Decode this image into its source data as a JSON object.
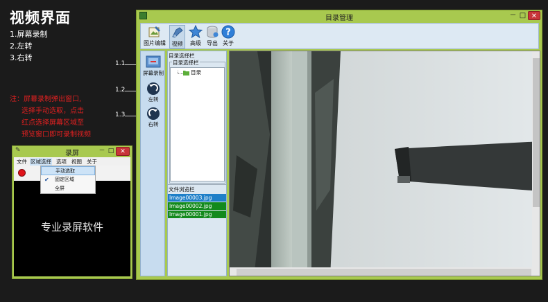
{
  "page": {
    "heading": "视频界面",
    "features": [
      "1.屏幕录制",
      "2.左转",
      "3.右转"
    ],
    "note": [
      "注：屏幕录制弹出窗口,",
      "选择手动选取，点击",
      "红点选择屏幕区域至",
      "预览窗口即可录制视频"
    ],
    "callouts": [
      "1.1",
      "1.2",
      "1.3"
    ]
  },
  "main_window": {
    "title": "目录管理",
    "window_buttons": {
      "minimize": "－",
      "maximize": "□",
      "close": "✕"
    },
    "toolbar": [
      {
        "label": "图片编辑",
        "icon": "image-edit-icon"
      },
      {
        "label": "视频",
        "icon": "video-icon"
      },
      {
        "label": "高级",
        "icon": "star-icon"
      },
      {
        "label": "导出",
        "icon": "database-export-icon"
      },
      {
        "label": "关于",
        "icon": "help-icon"
      }
    ],
    "left_tools": [
      {
        "label": "屏幕录制",
        "icon": "screen-record-icon"
      },
      {
        "label": "左转",
        "icon": "rotate-left-icon"
      },
      {
        "label": "右转",
        "icon": "rotate-right-icon"
      }
    ],
    "dir_panel": {
      "outer_title": "目录选择栏",
      "group_title": "目录选择栏",
      "tree_root": "目录"
    },
    "file_panel": {
      "title": "文件浏览栏",
      "files": [
        {
          "name": "Image00003.jpg",
          "color": "#1e7fc8"
        },
        {
          "name": "Image00002.jpg",
          "color": "#138a1d"
        },
        {
          "name": "Image00001.jpg",
          "color": "#138a1d"
        }
      ]
    }
  },
  "recorder_window": {
    "title": "录屏",
    "window_buttons": {
      "minimize": "－",
      "maximize": "□",
      "close": "✕"
    },
    "menu": [
      "文件",
      "区域选择",
      "选项",
      "视图",
      "关于"
    ],
    "dropdown": [
      {
        "label": "手动选取",
        "checked": false,
        "highlighted": true
      },
      {
        "label": "固定区域",
        "checked": true,
        "highlighted": false
      },
      {
        "label": "全屏",
        "checked": false,
        "highlighted": false
      }
    ],
    "canvas_text": "专业录屏软件"
  },
  "colors": {
    "window_frame": "#a8c94f",
    "note_text": "#e02020",
    "selected_file": "#1e7fc8",
    "file": "#138a1d"
  }
}
